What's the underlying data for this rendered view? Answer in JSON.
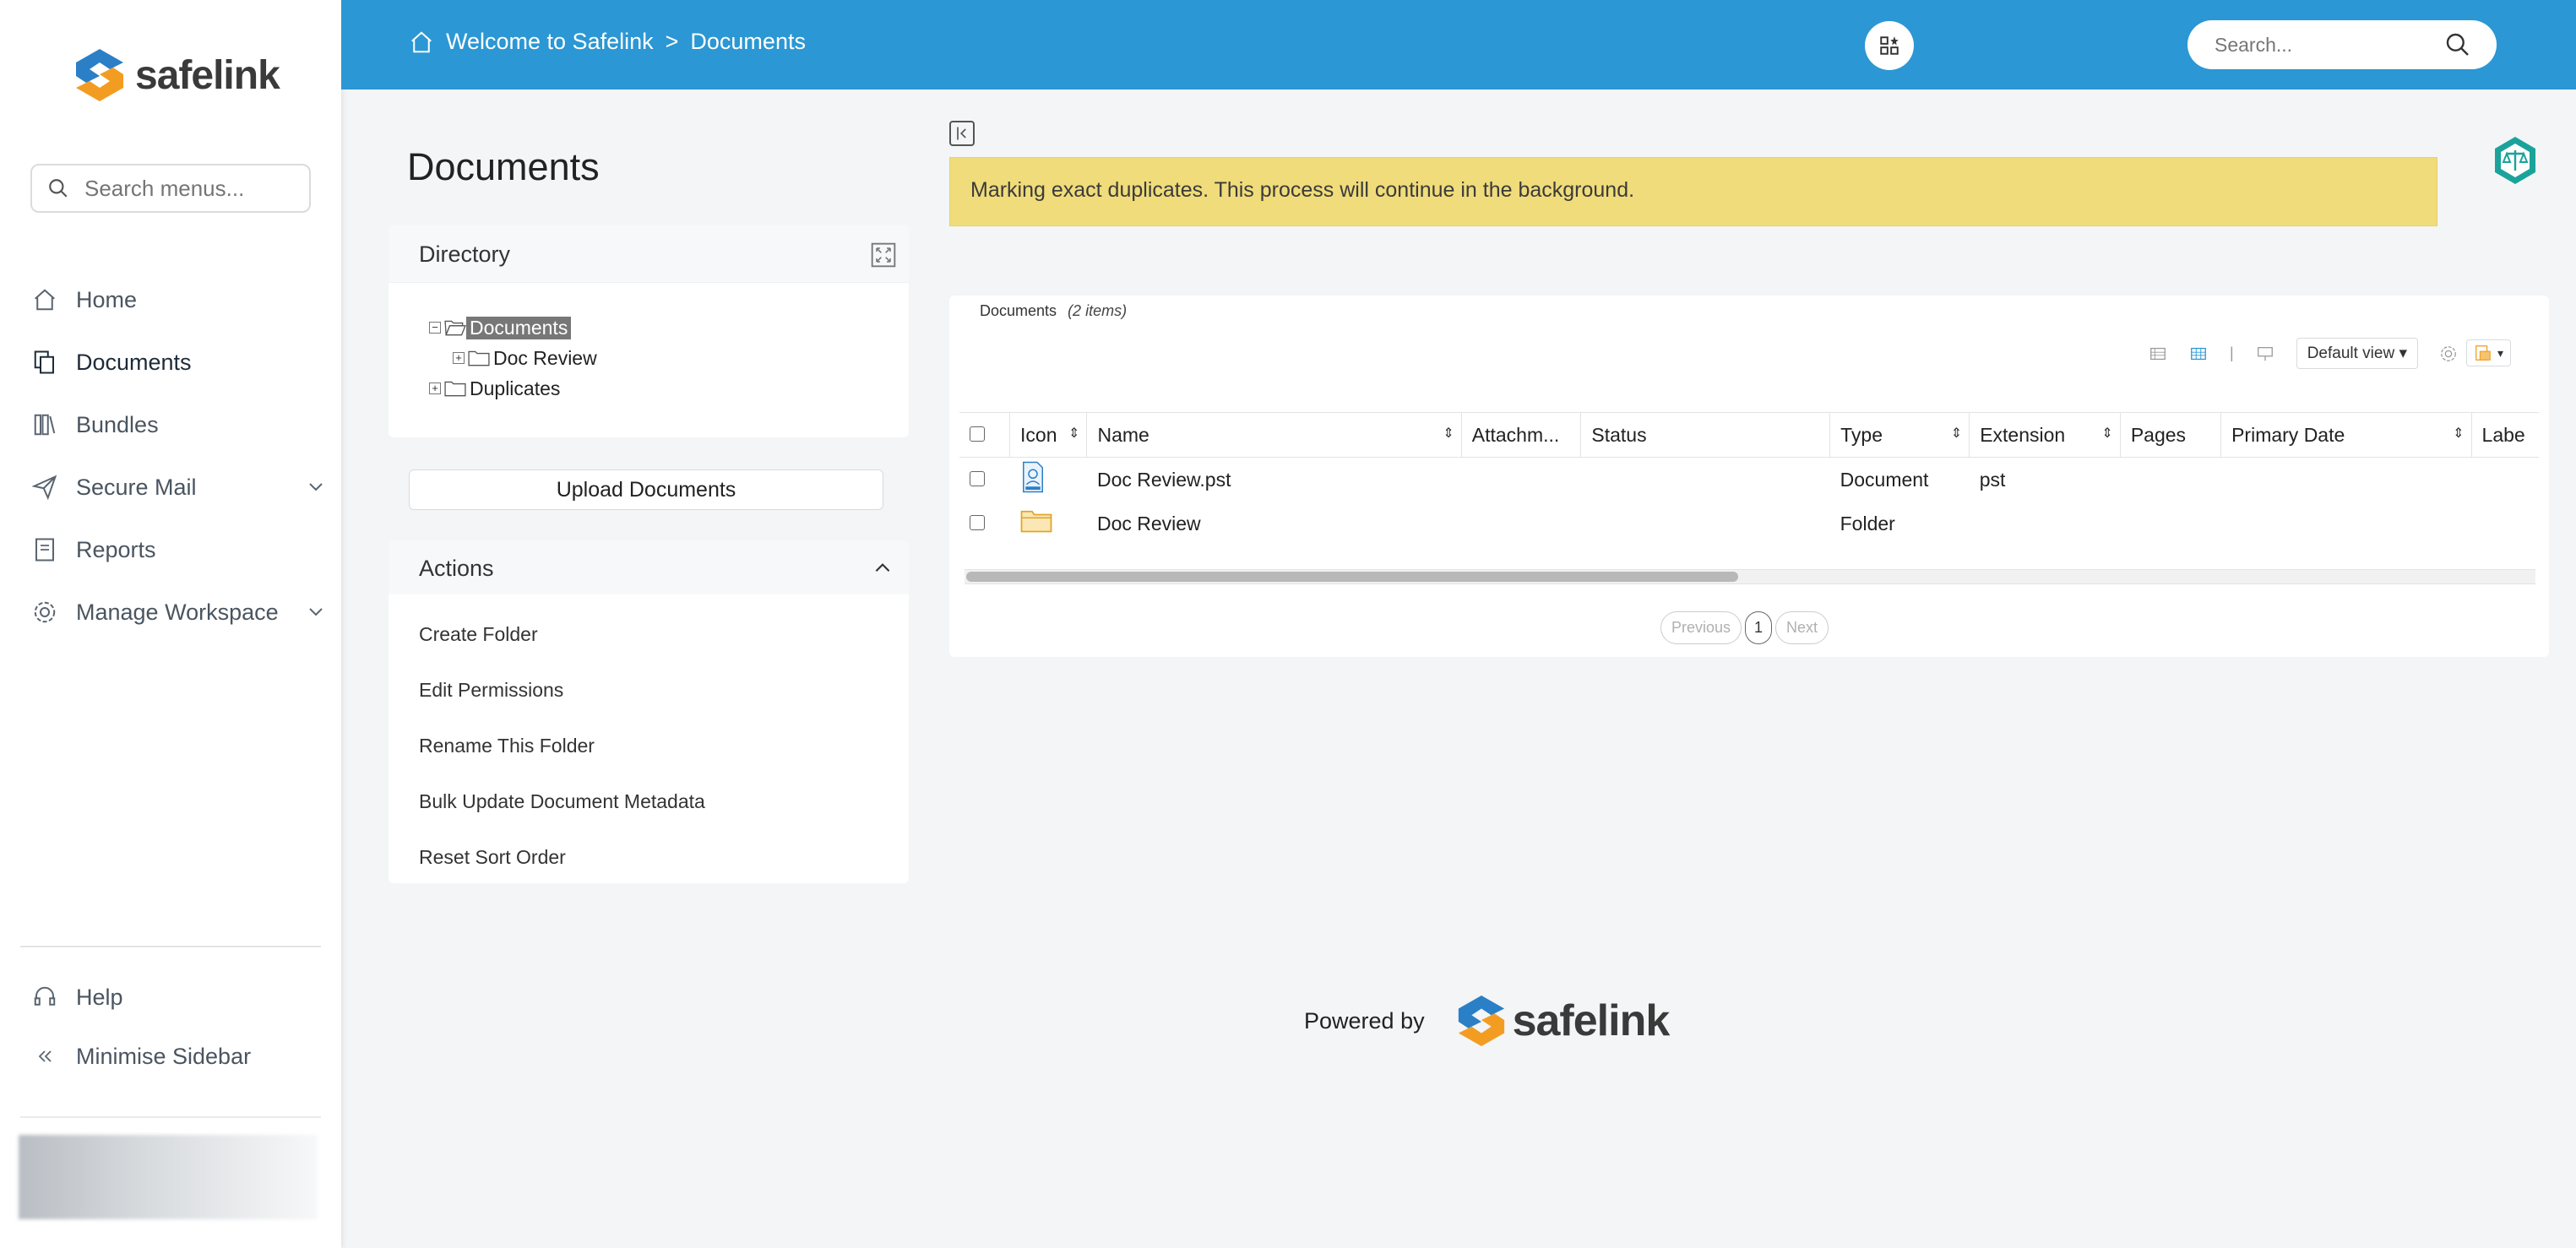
{
  "brand": {
    "name": "safelink"
  },
  "sidebar": {
    "search_placeholder": "Search menus...",
    "items": [
      {
        "label": "Home"
      },
      {
        "label": "Documents"
      },
      {
        "label": "Bundles"
      },
      {
        "label": "Secure Mail"
      },
      {
        "label": "Reports"
      },
      {
        "label": "Manage Workspace"
      }
    ],
    "help_label": "Help",
    "minimise_label": "Minimise Sidebar"
  },
  "topbar": {
    "breadcrumb_root": "Welcome to Safelink",
    "breadcrumb_sep": ">",
    "breadcrumb_current": "Documents",
    "search_placeholder": "Search..."
  },
  "page": {
    "title": "Documents"
  },
  "directory": {
    "title": "Directory",
    "tree": {
      "root": "Documents",
      "child": "Doc Review",
      "sibling": "Duplicates"
    }
  },
  "upload_label": "Upload Documents",
  "actions": {
    "title": "Actions",
    "items": [
      {
        "label": "Create Folder"
      },
      {
        "label": "Edit Permissions"
      },
      {
        "label": "Rename This Folder"
      },
      {
        "label": "Bulk Update Document Metadata"
      },
      {
        "label": "Reset Sort Order"
      }
    ]
  },
  "notice": {
    "text": "Marking exact duplicates. This process will continue in the background."
  },
  "grid": {
    "title": "Documents",
    "count_label": "(2 items)",
    "view_label": "Default view",
    "columns": [
      "Icon",
      "Name",
      "Attachm...",
      "Status",
      "Type",
      "Extension",
      "Pages",
      "Primary Date",
      "Labe"
    ],
    "rows": [
      {
        "name": "Doc Review.pst",
        "type": "Document",
        "extension": "pst",
        "icon": "document-icon"
      },
      {
        "name": "Doc Review",
        "type": "Folder",
        "extension": "",
        "icon": "folder-icon"
      }
    ],
    "pager": {
      "previous": "Previous",
      "page": "1",
      "next": "Next"
    }
  },
  "footer": {
    "powered_by": "Powered by"
  },
  "colors": {
    "topbar": "#2b97d4",
    "notice": "#f0dc7a",
    "accent_orange": "#f29d22",
    "accent_blue": "#2b7fc7"
  }
}
